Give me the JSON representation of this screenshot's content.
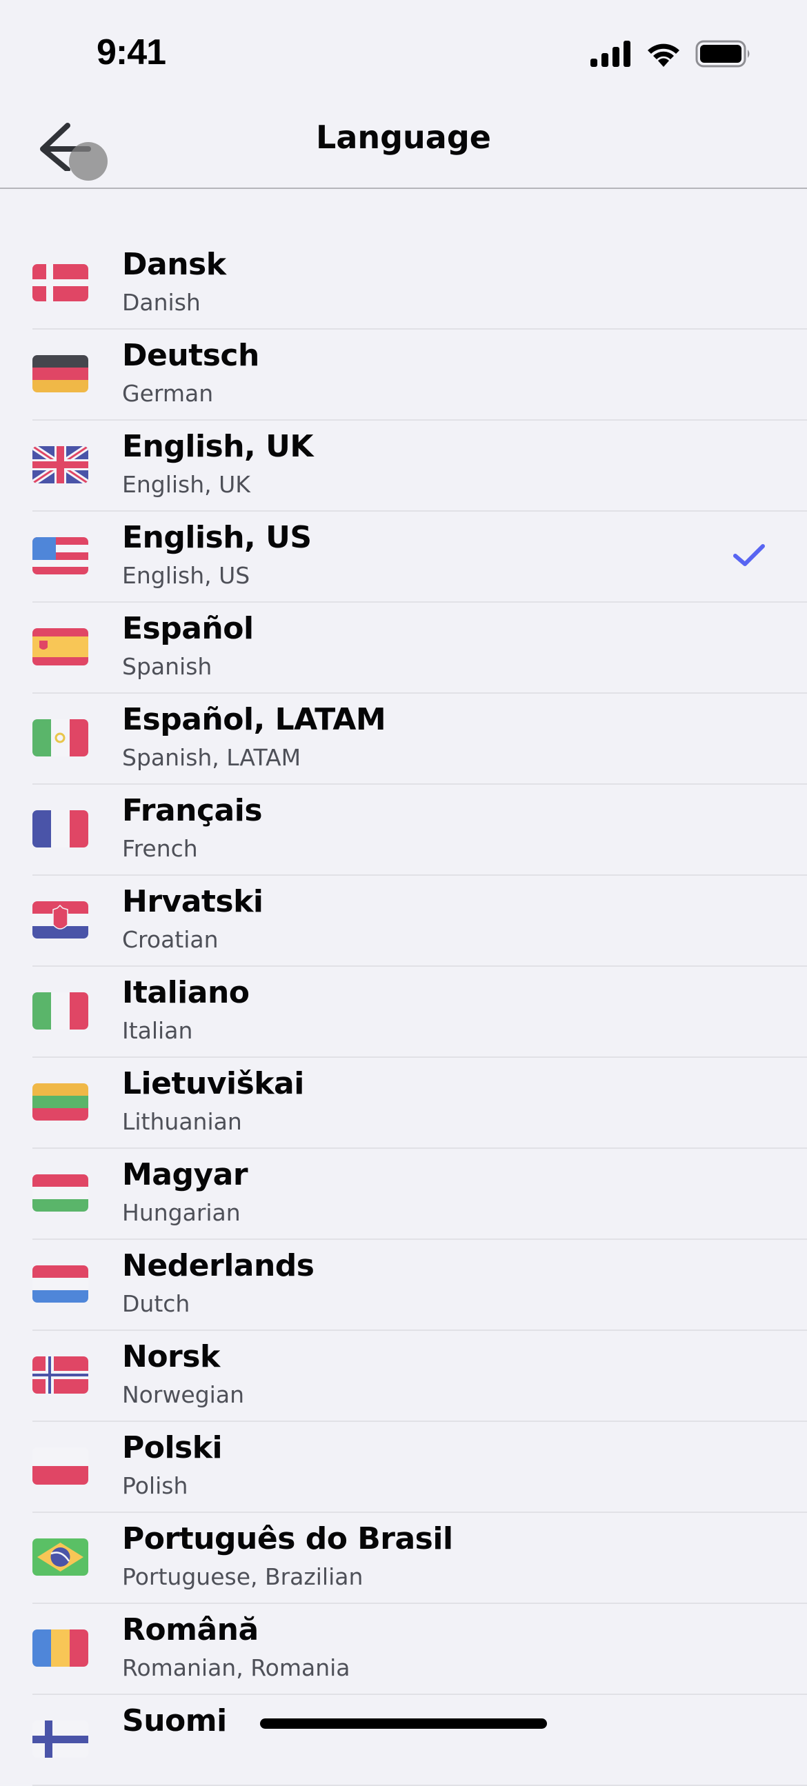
{
  "status_bar": {
    "time": "9:41",
    "icons": [
      "cellular-signal-icon",
      "wifi-icon",
      "battery-icon"
    ]
  },
  "nav": {
    "title": "Language",
    "back_icon": "arrow-left-icon"
  },
  "colors": {
    "background": "#f2f2f7",
    "accent": "#5865f2",
    "text_primary": "#060607",
    "text_secondary": "#4e5058",
    "separator": "#e1e1e6"
  },
  "selected_language": "English, US",
  "languages": [
    {
      "name": "Dansk",
      "english": "Danish",
      "flag": "denmark",
      "selected": false
    },
    {
      "name": "Deutsch",
      "english": "German",
      "flag": "germany",
      "selected": false
    },
    {
      "name": "English, UK",
      "english": "English, UK",
      "flag": "united-kingdom",
      "selected": false
    },
    {
      "name": "English, US",
      "english": "English, US",
      "flag": "united-states",
      "selected": true
    },
    {
      "name": "Español",
      "english": "Spanish",
      "flag": "spain",
      "selected": false
    },
    {
      "name": "Español, LATAM",
      "english": "Spanish, LATAM",
      "flag": "mexico",
      "selected": false
    },
    {
      "name": "Français",
      "english": "French",
      "flag": "france",
      "selected": false
    },
    {
      "name": "Hrvatski",
      "english": "Croatian",
      "flag": "croatia",
      "selected": false
    },
    {
      "name": "Italiano",
      "english": "Italian",
      "flag": "italy",
      "selected": false
    },
    {
      "name": "Lietuviškai",
      "english": "Lithuanian",
      "flag": "lithuania",
      "selected": false
    },
    {
      "name": "Magyar",
      "english": "Hungarian",
      "flag": "hungary",
      "selected": false
    },
    {
      "name": "Nederlands",
      "english": "Dutch",
      "flag": "netherlands",
      "selected": false
    },
    {
      "name": "Norsk",
      "english": "Norwegian",
      "flag": "norway",
      "selected": false
    },
    {
      "name": "Polski",
      "english": "Polish",
      "flag": "poland",
      "selected": false
    },
    {
      "name": "Português do Brasil",
      "english": "Portuguese, Brazilian",
      "flag": "brazil",
      "selected": false
    },
    {
      "name": "Română",
      "english": "Romanian, Romania",
      "flag": "romania",
      "selected": false
    },
    {
      "name": "Suomi",
      "english": "",
      "flag": "finland",
      "selected": false
    }
  ]
}
